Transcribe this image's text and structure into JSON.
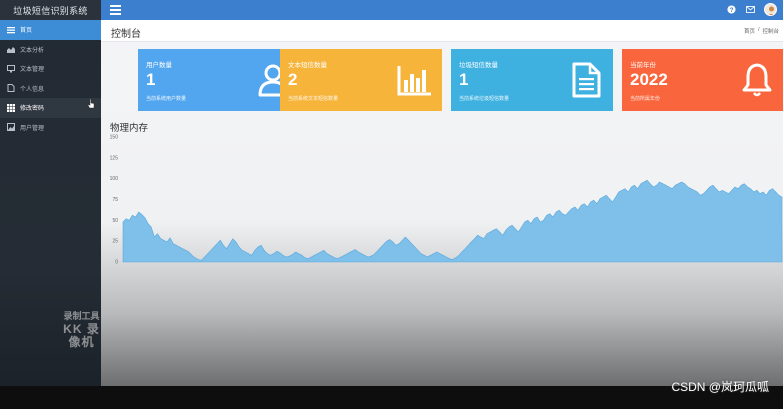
{
  "app": {
    "title": "垃圾短信识别系统"
  },
  "sidebar": {
    "items": [
      {
        "label": "首页",
        "icon": "list-icon",
        "state": "active"
      },
      {
        "label": "文本分析",
        "icon": "area-chart-icon",
        "state": ""
      },
      {
        "label": "文本管理",
        "icon": "monitor-icon",
        "state": ""
      },
      {
        "label": "个人信息",
        "icon": "document-icon",
        "state": ""
      },
      {
        "label": "修改密码",
        "icon": "grid-icon",
        "state": "hover"
      },
      {
        "label": "用户管理",
        "icon": "image-icon",
        "state": ""
      }
    ]
  },
  "topbar": {
    "icons": [
      "help-icon",
      "mail-icon",
      "avatar"
    ]
  },
  "header": {
    "title": "控制台",
    "breadcrumb": [
      "首页",
      "/",
      "控制台"
    ]
  },
  "cards": [
    {
      "label": "用户数量",
      "value": "1",
      "sub": "当前系统用户数量",
      "color": "#52a6ef",
      "icon": "user-icon"
    },
    {
      "label": "文本短信数量",
      "value": "2",
      "sub": "当前系统文本短信数量",
      "color": "#f6b43a",
      "icon": "bar-chart-icon"
    },
    {
      "label": "垃圾短信数量",
      "value": "1",
      "sub": "当前系统垃圾短信数量",
      "color": "#3eb1e1",
      "icon": "file-icon"
    },
    {
      "label": "当前年份",
      "value": "2022",
      "sub": "当前所属年份",
      "color": "#f9653c",
      "icon": "bell-icon"
    }
  ],
  "memory": {
    "title": "物理内存"
  },
  "chart_data": {
    "type": "area",
    "title": "物理内存",
    "yticks": [
      "150",
      "125",
      "100",
      "75",
      "50",
      "25",
      "0"
    ],
    "ylim": [
      0,
      150
    ],
    "color": "#7ec0ea",
    "values": [
      48,
      52,
      50,
      56,
      54,
      60,
      57,
      53,
      46,
      42,
      30,
      34,
      28,
      26,
      24,
      29,
      22,
      20,
      18,
      16,
      14,
      12,
      8,
      5,
      3,
      2,
      6,
      10,
      14,
      18,
      22,
      26,
      20,
      16,
      22,
      28,
      24,
      18,
      14,
      12,
      10,
      8,
      14,
      18,
      20,
      14,
      10,
      8,
      10,
      13,
      11,
      8,
      6,
      7,
      9,
      12,
      10,
      8,
      5,
      4,
      6,
      8,
      10,
      12,
      14,
      10,
      8,
      6,
      4,
      5,
      7,
      9,
      11,
      13,
      15,
      12,
      10,
      8,
      6,
      7,
      9,
      13,
      17,
      21,
      25,
      27,
      24,
      20,
      22,
      26,
      30,
      26,
      22,
      18,
      14,
      10,
      8,
      6,
      8,
      10,
      12,
      10,
      8,
      6,
      4,
      3,
      5,
      8,
      12,
      16,
      20,
      24,
      28,
      32,
      30,
      28,
      34,
      36,
      38,
      40,
      36,
      32,
      38,
      42,
      44,
      40,
      36,
      42,
      48,
      50,
      46,
      52,
      54,
      48,
      50,
      56,
      58,
      54,
      60,
      62,
      58,
      56,
      60,
      64,
      66,
      62,
      68,
      70,
      66,
      72,
      74,
      70,
      76,
      78,
      80,
      76,
      72,
      78,
      84,
      86,
      88,
      84,
      90,
      92,
      88,
      94,
      96,
      98,
      94,
      90,
      92,
      96,
      94,
      92,
      90,
      88,
      92,
      94,
      96,
      94,
      90,
      88,
      86,
      84,
      80,
      82,
      86,
      90,
      92,
      88,
      84,
      86,
      84,
      82,
      86,
      90,
      88,
      92,
      94,
      90,
      88,
      84,
      86,
      82,
      84,
      80,
      86,
      88,
      84,
      80,
      78
    ]
  },
  "watermark": {
    "line1": "录制工具",
    "line2": "KK 录像机",
    "csdn": "CSDN @岚珂瓜呱"
  }
}
